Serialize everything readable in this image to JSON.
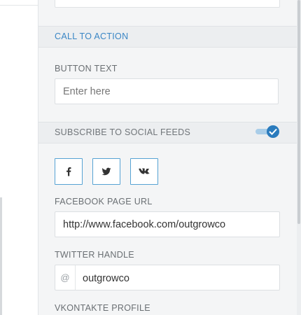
{
  "sections": {
    "call_to_action": "CALL TO ACTION",
    "subscribe_social": "SUBSCRIBE TO SOCIAL FEEDS"
  },
  "button_text": {
    "label": "BUTTON TEXT",
    "placeholder": "Enter here",
    "value": ""
  },
  "subscribe_toggle": {
    "on": true
  },
  "social_buttons": [
    {
      "icon": "facebook-icon"
    },
    {
      "icon": "twitter-icon"
    },
    {
      "icon": "vkontakte-icon"
    }
  ],
  "facebook": {
    "label": "FACEBOOK PAGE URL",
    "value": "http://www.facebook.com/outgrowco"
  },
  "twitter": {
    "label": "TWITTER HANDLE",
    "prefix": "@",
    "value": "outgrowco"
  },
  "vkontakte": {
    "label": "VKONTAKTE PROFILE"
  },
  "colors": {
    "accent": "#2a7bbd",
    "section_link": "#3a86c5",
    "social_border": "#56a3d4"
  }
}
